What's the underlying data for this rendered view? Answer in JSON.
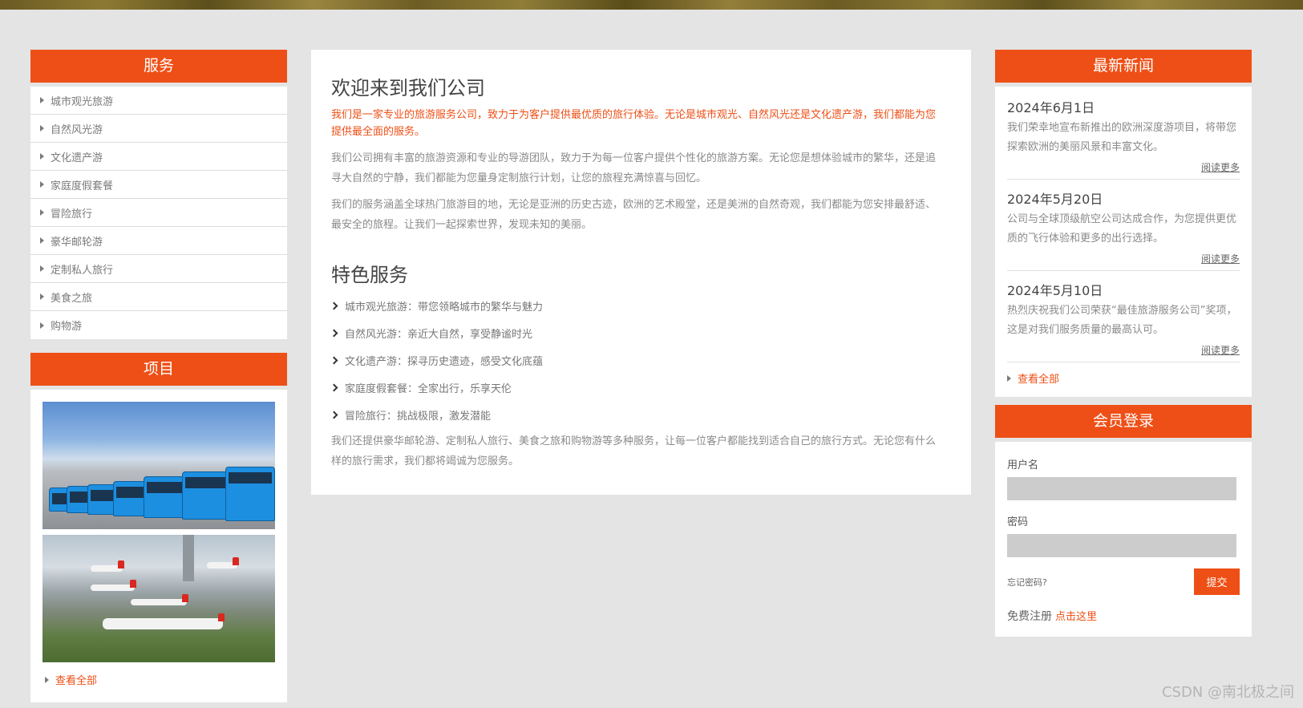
{
  "services": {
    "title": "服务",
    "items": [
      "城市观光旅游",
      "自然风光游",
      "文化遗产游",
      "家庭度假套餐",
      "冒险旅行",
      "豪华邮轮游",
      "定制私人旅行",
      "美食之旅",
      "购物游"
    ]
  },
  "projects": {
    "title": "项目",
    "view_all": "查看全部"
  },
  "welcome": {
    "title": "欢迎来到我们公司",
    "intro": "我们是一家专业的旅游服务公司，致力于为客户提供最优质的旅行体验。无论是城市观光、自然风光还是文化遗产游，我们都能为您提供最全面的服务。",
    "para1": "我们公司拥有丰富的旅游资源和专业的导游团队，致力于为每一位客户提供个性化的旅游方案。无论您是想体验城市的繁华，还是追寻大自然的宁静，我们都能为您量身定制旅行计划，让您的旅程充满惊喜与回忆。",
    "para2": "我们的服务涵盖全球热门旅游目的地，无论是亚洲的历史古迹，欧洲的艺术殿堂，还是美洲的自然奇观，我们都能为您安排最舒适、最安全的旅程。让我们一起探索世界，发现未知的美丽。"
  },
  "features": {
    "title": "特色服务",
    "items": [
      "城市观光旅游：带您领略城市的繁华与魅力",
      "自然风光游：亲近大自然，享受静谧时光",
      "文化遗产游：探寻历史遗迹，感受文化底蕴",
      "家庭度假套餐：全家出行，乐享天伦",
      "冒险旅行：挑战极限，激发潜能"
    ],
    "closing": "我们还提供豪华邮轮游、定制私人旅行、美食之旅和购物游等多种服务，让每一位客户都能找到适合自己的旅行方式。无论您有什么样的旅行需求，我们都将竭诚为您服务。"
  },
  "news": {
    "title": "最新新闻",
    "items": [
      {
        "date": "2024年6月1日",
        "text": "我们荣幸地宣布新推出的欧洲深度游项目，将带您探索欧洲的美丽风景和丰富文化。",
        "more": "阅读更多"
      },
      {
        "date": "2024年5月20日",
        "text": "公司与全球顶级航空公司达成合作，为您提供更优质的飞行体验和更多的出行选择。",
        "more": "阅读更多"
      },
      {
        "date": "2024年5月10日",
        "text": "热烈庆祝我们公司荣获“最佳旅游服务公司”奖项，这是对我们服务质量的最高认可。",
        "more": "阅读更多"
      }
    ],
    "view_all": "查看全部"
  },
  "login": {
    "title": "会员登录",
    "username_label": "用户名",
    "password_label": "密码",
    "forgot": "忘记密码?",
    "submit": "提交",
    "register_text": "免费注册",
    "register_link": "点击这里"
  },
  "watermark": "CSDN @南北极之间",
  "colors": {
    "accent": "#ee4f16",
    "background": "#e4e4e4"
  }
}
